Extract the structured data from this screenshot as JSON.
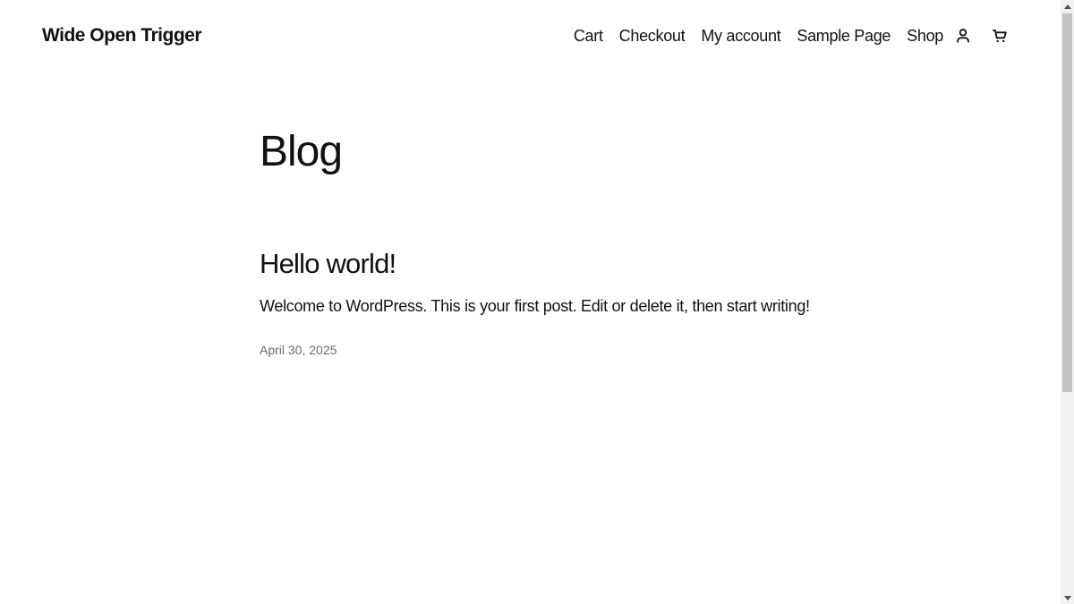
{
  "header": {
    "site_title": "Wide Open Trigger",
    "nav": {
      "items": [
        {
          "label": "Cart"
        },
        {
          "label": "Checkout"
        },
        {
          "label": "My account"
        },
        {
          "label": "Sample Page"
        },
        {
          "label": "Shop"
        }
      ],
      "account_icon": "person-icon",
      "cart_icon": "cart-icon"
    }
  },
  "main": {
    "page_title": "Blog",
    "posts": [
      {
        "title": "Hello world!",
        "excerpt": "Welcome to WordPress. This is your first post. Edit or delete it, then start writing!",
        "date": "April 30, 2025"
      }
    ]
  },
  "colors": {
    "text": "#111111",
    "muted": "#6b6b6b",
    "background": "#ffffff"
  }
}
